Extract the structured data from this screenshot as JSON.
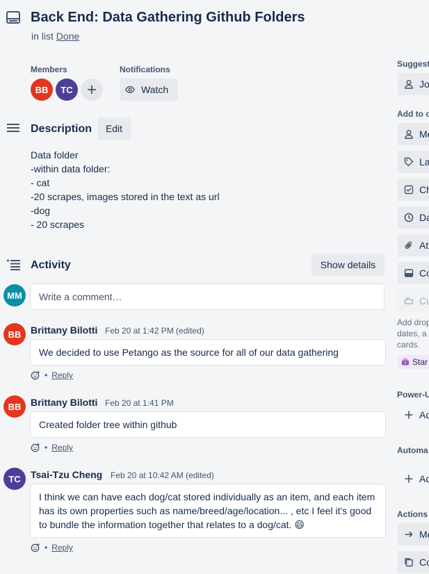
{
  "card": {
    "title": "Back End: Data Gathering Github Folders",
    "in_list_prefix": "in list",
    "list_name": "Done"
  },
  "members": {
    "label": "Members",
    "avatars": [
      "BB",
      "TC"
    ]
  },
  "notifications": {
    "label": "Notifications",
    "watch_label": "Watch"
  },
  "description": {
    "title": "Description",
    "edit_label": "Edit",
    "lines": [
      "Data folder",
      "-within data folder:",
      "- cat",
      "-20 scrapes, images stored in the text as url",
      "-dog",
      "- 20 scrapes"
    ]
  },
  "activity": {
    "title": "Activity",
    "show_details_label": "Show details",
    "current_user_initials": "MM",
    "comment_placeholder": "Write a comment…",
    "comments": [
      {
        "initials": "BB",
        "author": "Brittany Bilotti",
        "timestamp": "Feb 20 at 1:42 PM (edited)",
        "text": "We decided to use Petango as the source for all of our data gathering",
        "reply_label": "Reply"
      },
      {
        "initials": "BB",
        "author": "Brittany Bilotti",
        "timestamp": "Feb 20 at 1:41 PM",
        "text": "Created folder tree within github",
        "reply_label": "Reply"
      },
      {
        "initials": "TC",
        "author": "Tsai-Tzu Cheng",
        "timestamp": "Feb 20 at 10:42 AM (edited)",
        "text": "I think we can have each dog/cat stored individually as an item, and each item has its own properties such as name/breed/age/location... , etc I feel it's good to bundle the information together that relates to a dog/cat. 😄",
        "reply_label": "Reply"
      }
    ]
  },
  "sidebar": {
    "suggested_heading": "Suggest",
    "join_label": "Jo",
    "add_to_card_heading": "Add to c",
    "add_items": [
      "Me",
      "La",
      "Ch",
      "Da",
      "At",
      "Co",
      "Cu"
    ],
    "add_note_lines": [
      "Add drop",
      "dates, a",
      "cards."
    ],
    "start_chip_label": "Star",
    "powerups_heading": "Power-U",
    "powerups_add": "Ad",
    "automation_heading": "Automa",
    "automation_add": "Ad",
    "actions_heading": "Actions",
    "action_items": [
      "Mo",
      "Co"
    ]
  },
  "colors": {
    "avatar_bb": "#e2361f",
    "avatar_tc": "#4c3f99",
    "avatar_mm": "#0b8fa6",
    "text_primary": "#172b4d",
    "text_subtle": "#44546f"
  }
}
